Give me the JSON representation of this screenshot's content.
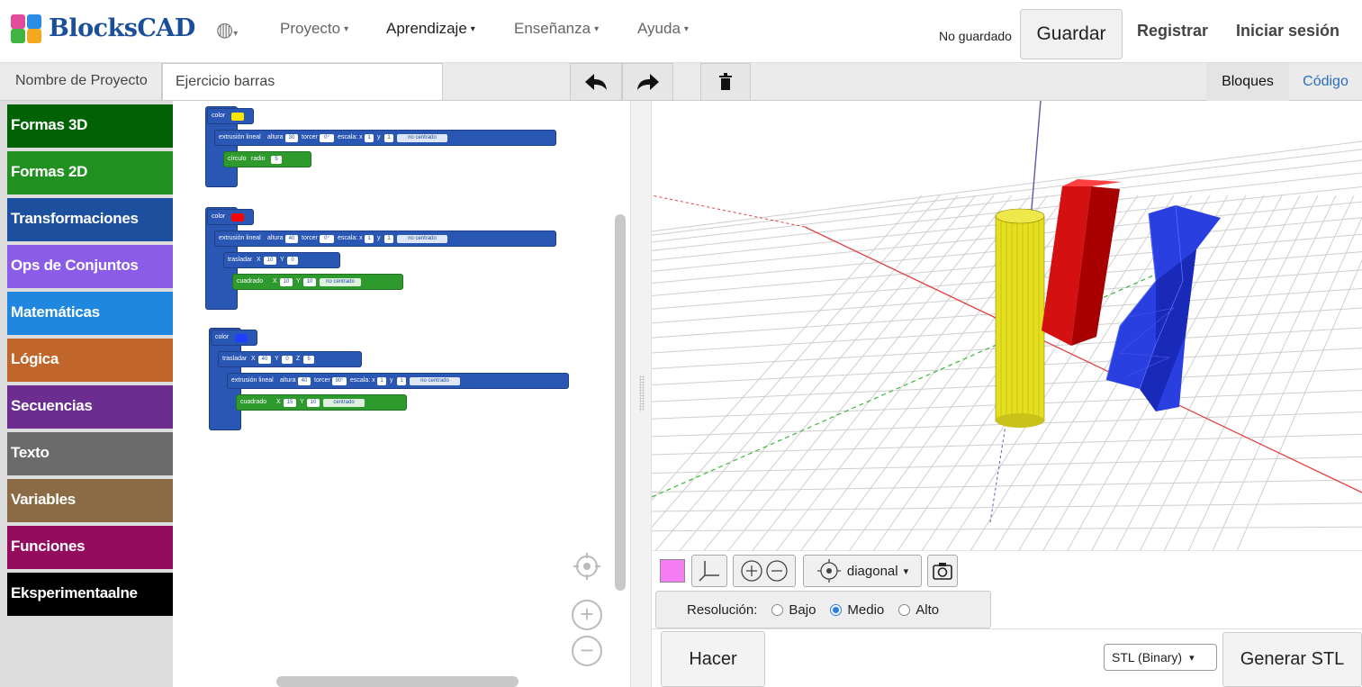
{
  "app": {
    "name": "BlocksCAD",
    "language_icon": "globe-icon"
  },
  "menu": {
    "project": "Proyecto",
    "learning": "Aprendizaje",
    "teaching": "Enseñanza",
    "help": "Ayuda"
  },
  "status": {
    "unsaved": "No guardado"
  },
  "header_actions": {
    "save": "Guardar",
    "register": "Registrar",
    "login": "Iniciar sesión"
  },
  "project": {
    "label": "Nombre de Proyecto",
    "name": "Ejercicio barras"
  },
  "toolbar_icons": [
    "undo-icon",
    "redo-icon",
    "trash-icon"
  ],
  "view_tabs": {
    "blocks": "Bloques",
    "code": "Código"
  },
  "categories": [
    {
      "label": "Formas 3D",
      "color": "#006205"
    },
    {
      "label": "Formas 2D",
      "color": "#209021"
    },
    {
      "label": "Transformaciones",
      "color": "#1d4f9f"
    },
    {
      "label": "Ops de Conjuntos",
      "color": "#8a5ce8"
    },
    {
      "label": "Matemáticas",
      "color": "#1f87e0"
    },
    {
      "label": "Lógica",
      "color": "#c0662a"
    },
    {
      "label": "Secuencias",
      "color": "#6b2d8f"
    },
    {
      "label": "Texto",
      "color": "#6b6b6b"
    },
    {
      "label": "Variables",
      "color": "#8b6b45"
    },
    {
      "label": "Funciones",
      "color": "#940c5d"
    },
    {
      "label": "Eksperimentaalne",
      "color": "#000000"
    }
  ],
  "block_groups": [
    {
      "color": {
        "label": "color",
        "value": "#ffe600"
      },
      "extrude": {
        "label": "extrusión lineal",
        "height_label": "altura",
        "height": "30",
        "twist_label": "torcer",
        "twist": "0°",
        "scale_label": "escala: x",
        "scale_x": "1",
        "y_label": "y",
        "scale_y": "1",
        "center": "no centrado"
      },
      "shape": {
        "label": "círculo",
        "param_label": "radio",
        "param": "5"
      }
    },
    {
      "color": {
        "label": "color",
        "value": "#ff0000"
      },
      "extrude": {
        "label": "extrusión lineal",
        "height_label": "altura",
        "height": "40",
        "twist_label": "torcer",
        "twist": "0°",
        "scale_label": "escala: x",
        "scale_x": "1",
        "y_label": "y",
        "scale_y": "1",
        "center": "no centrado"
      },
      "translate": {
        "label": "trasladar",
        "x_label": "X",
        "x": "10",
        "y_label": "Y",
        "y": "0"
      },
      "shape": {
        "label": "cuadrado",
        "x_label": "X",
        "x": "10",
        "y_label": "Y",
        "y": "10",
        "center": "no centrado"
      }
    },
    {
      "color": {
        "label": "color",
        "value": "#1f3fff"
      },
      "translate": {
        "label": "trasladar",
        "x_label": "X",
        "x": "40",
        "y_label": "Y",
        "y": "0",
        "z_label": "Z",
        "z": "5"
      },
      "extrude": {
        "label": "extrusión lineal",
        "height_label": "altura",
        "height": "40",
        "twist_label": "torcer",
        "twist": "90°",
        "scale_label": "escala: x",
        "scale_x": "1",
        "y_label": "y",
        "scale_y": "1",
        "center": "no centrado"
      },
      "shape": {
        "label": "cuadrado",
        "x_label": "X",
        "x": "15",
        "y_label": "Y",
        "y": "10",
        "center": "centrado"
      }
    }
  ],
  "workspace_controls": [
    "target-icon",
    "zoom-in-icon",
    "zoom-out-icon"
  ],
  "viewer": {
    "color_swatch": "#f47df4",
    "camera_view": "diagonal",
    "tool_icons": [
      "axes-icon",
      "zoom-in-icon",
      "zoom-out-icon",
      "target-icon",
      "camera-icon"
    ],
    "objects": [
      {
        "name": "yellow-cylinder",
        "color": "#e6df1f"
      },
      {
        "name": "red-bar",
        "color": "#d41010"
      },
      {
        "name": "blue-twisted-bar",
        "color": "#2a3fe0"
      }
    ]
  },
  "resolution": {
    "label": "Resolución:",
    "low": "Bajo",
    "medium": "Medio",
    "high": "Alto",
    "selected": "Medio"
  },
  "actions": {
    "render": "Hacer",
    "format": "STL (Binary)",
    "generate": "Generar STL"
  }
}
